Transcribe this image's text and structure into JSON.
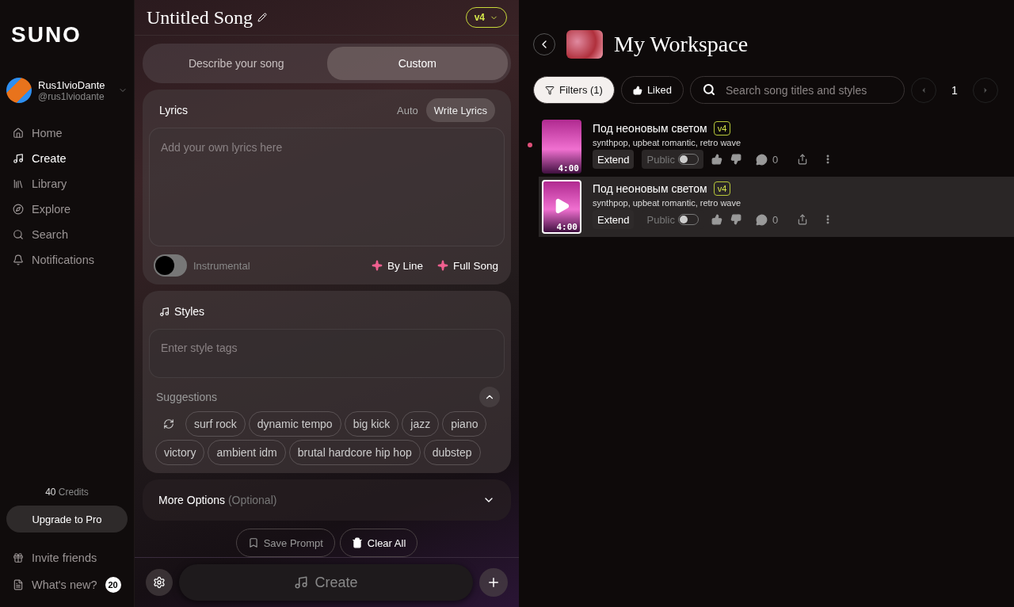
{
  "logo": "SUNO",
  "user": {
    "name": "Rus1lvioDante",
    "handle": "@rus1lviodante"
  },
  "nav": [
    {
      "label": "Home",
      "selected": false
    },
    {
      "label": "Create",
      "selected": true
    },
    {
      "label": "Library",
      "selected": false
    },
    {
      "label": "Explore",
      "selected": false
    },
    {
      "label": "Search",
      "selected": false
    },
    {
      "label": "Notifications",
      "selected": false
    }
  ],
  "credits": {
    "count": "40",
    "label": "Credits"
  },
  "upgrade": "Upgrade to Pro",
  "footer_links": [
    {
      "label": "Invite friends"
    },
    {
      "label": "What's new?",
      "badge": "20"
    }
  ],
  "song_title": "Untitled Song",
  "model": "v4",
  "mode_tabs": [
    {
      "label": "Describe your song",
      "selected": false
    },
    {
      "label": "Custom",
      "selected": true
    }
  ],
  "lyrics": {
    "title": "Lyrics",
    "modes": [
      {
        "label": "Auto",
        "selected": false
      },
      {
        "label": "Write Lyrics",
        "selected": true
      }
    ],
    "placeholder": "Add your own lyrics here",
    "instrumental": {
      "label": "Instrumental",
      "on": false
    },
    "actions": [
      "By Line",
      "Full Song"
    ]
  },
  "styles": {
    "title": "Styles",
    "placeholder": "Enter style tags",
    "suggestions_label": "Suggestions",
    "expanded": true,
    "tags": [
      "surf rock",
      "dynamic tempo",
      "big kick",
      "jazz",
      "piano",
      "victory",
      "ambient idm",
      "brutal hardcore hip hop",
      "dubstep"
    ]
  },
  "more_options": {
    "label": "More Options",
    "hint": "(Optional)"
  },
  "save_prompt": "Save Prompt",
  "clear_all": "Clear All",
  "create": "Create",
  "workspace": {
    "title": "My Workspace",
    "filters": "Filters (1)",
    "liked": "Liked",
    "search_placeholder": "Search song titles and styles",
    "page": "1"
  },
  "songs": [
    {
      "title": "Под неоновым светом",
      "version": "v4",
      "tags": "synthpop, upbeat romantic, retro wave",
      "duration": "4:00",
      "extend": "Extend",
      "public_label": "Public",
      "public": false,
      "comments": "0",
      "selected": false,
      "new": true
    },
    {
      "title": "Под неоновым светом",
      "version": "v4",
      "tags": "synthpop, upbeat romantic, retro wave",
      "duration": "4:00",
      "extend": "Extend",
      "public_label": "Public",
      "public": false,
      "comments": "0",
      "selected": true,
      "new": false
    }
  ]
}
